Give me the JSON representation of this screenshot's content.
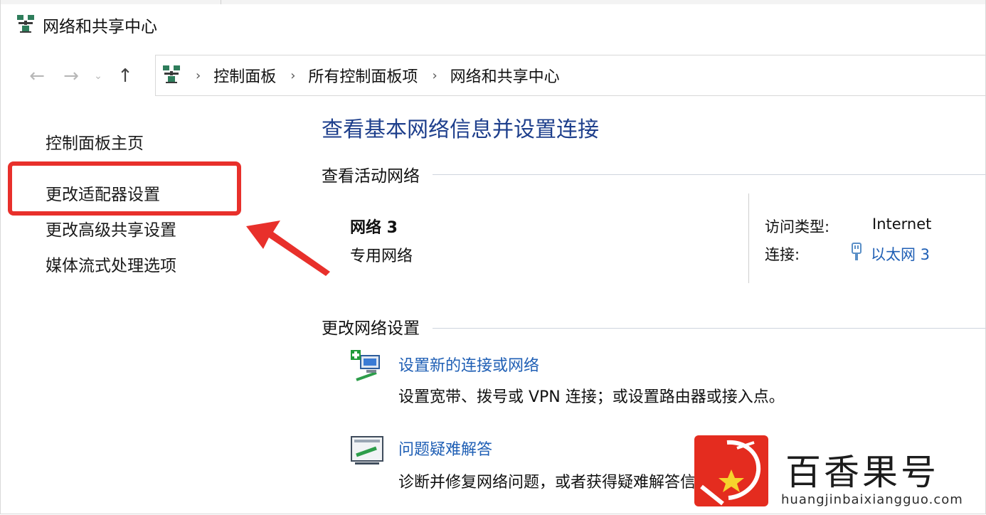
{
  "window": {
    "title": "网络和共享中心"
  },
  "nav": {
    "back_icon": "←",
    "forward_icon": "→",
    "recent_icon": "⌄",
    "up_icon": "↑"
  },
  "breadcrumb": [
    "控制面板",
    "所有控制面板项",
    "网络和共享中心"
  ],
  "sidebar": {
    "items": [
      {
        "label": "控制面板主页"
      },
      {
        "label": "更改适配器设置"
      },
      {
        "label": "更改高级共享设置"
      },
      {
        "label": "媒体流式处理选项"
      }
    ]
  },
  "main": {
    "title": "查看基本网络信息并设置连接",
    "active_section": "查看活动网络",
    "network": {
      "name": "网络 3",
      "type": "专用网络",
      "access_label": "访问类型:",
      "access_value": "Internet",
      "connection_label": "连接:",
      "connection_value": "以太网 3"
    },
    "change_section": "更改网络设置",
    "tasks": [
      {
        "link": "设置新的连接或网络",
        "desc": "设置宽带、拨号或 VPN 连接；或设置路由器或接入点。"
      },
      {
        "link": "问题疑难解答",
        "desc": "诊断并修复网络问题，或者获得疑难解答信息。"
      }
    ]
  },
  "watermark": {
    "brand": "百香果号",
    "url": "huangjinbaixiangguo.com"
  },
  "colors": {
    "accent_title": "#1e3f8c",
    "link": "#1f5fb5",
    "highlight": "#e8302b",
    "watermark": "#e42c1f"
  }
}
